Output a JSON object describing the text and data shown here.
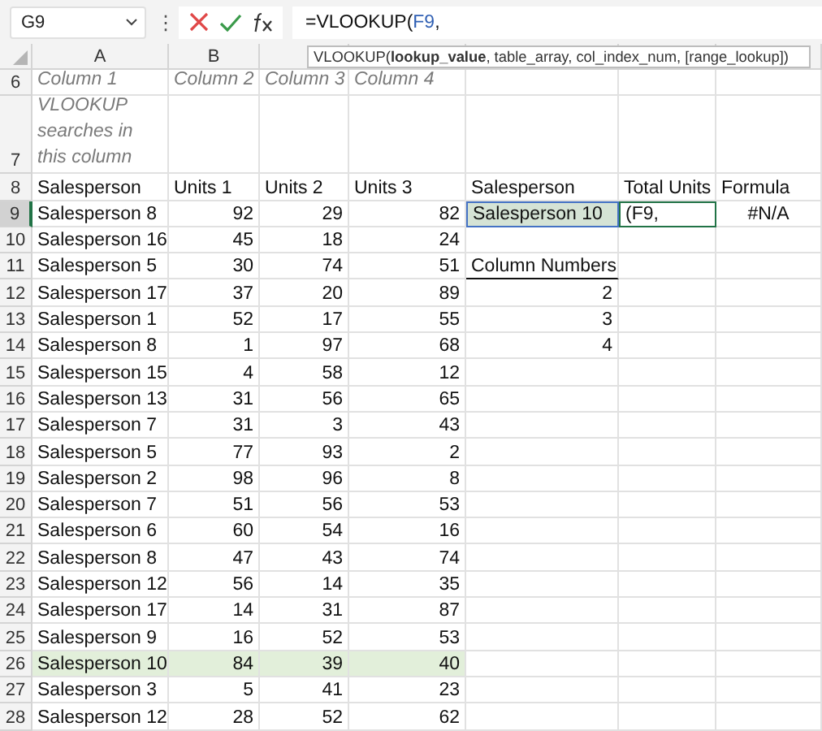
{
  "formula_bar": {
    "name_box": "G9",
    "separator": "⋮",
    "formula_start": "=VLOOKUP(",
    "formula_reference": "F9",
    "formula_end": ","
  },
  "tooltip": {
    "text": "VLOOKUP(**lookup_value**, table_array, col_index_num, [range_lookup])"
  },
  "column_headers": [
    "A",
    "B"
  ],
  "rows": [
    {
      "number": "6",
      "kind": "caption",
      "selected": false,
      "highlighted": false,
      "cells": [
        {
          "text": "Column 1",
          "kind": "text"
        },
        {
          "text": "Column 2",
          "kind": "text"
        },
        {
          "text": "Column 3",
          "kind": "text"
        },
        {
          "text": "Column 4",
          "kind": "text"
        }
      ]
    },
    {
      "number": "7",
      "kind": "caption",
      "selected": false,
      "highlighted": false,
      "cells": [
        {
          "text": "VLOOKUP searches in this column",
          "kind": "text"
        }
      ]
    },
    {
      "number": "8",
      "kind": "header",
      "selected": false,
      "highlighted": false,
      "cells": [
        {
          "text": "Salesperson",
          "kind": "text"
        },
        {
          "text": "Units 1",
          "kind": "text"
        },
        {
          "text": "Units 2",
          "kind": "text"
        },
        {
          "text": "Units 3",
          "kind": "text"
        },
        {
          "text": "Salesperson",
          "kind": "text"
        },
        {
          "text": "Total Units",
          "kind": "text"
        },
        {
          "text": "Formula",
          "kind": "text"
        }
      ]
    },
    {
      "number": "9",
      "kind": "data",
      "selected": true,
      "highlighted": false,
      "cells": [
        {
          "text": "Salesperson 8",
          "kind": "text"
        },
        {
          "text": "92",
          "kind": "number"
        },
        {
          "text": "29",
          "kind": "number"
        },
        {
          "text": "82",
          "kind": "number"
        },
        {
          "text": "Salesperson 10",
          "kind": "reference"
        },
        {
          "text": "(F9,",
          "kind": "editing"
        },
        {
          "text": "#N/A",
          "kind": "error"
        }
      ]
    },
    {
      "number": "10",
      "kind": "data",
      "selected": false,
      "highlighted": false,
      "cells": [
        {
          "text": "Salesperson 16",
          "kind": "text"
        },
        {
          "text": "45",
          "kind": "number"
        },
        {
          "text": "18",
          "kind": "number"
        },
        {
          "text": "24",
          "kind": "number"
        }
      ]
    },
    {
      "number": "11",
      "kind": "data",
      "selected": false,
      "highlighted": false,
      "cells": [
        {
          "text": "Salesperson 5",
          "kind": "text"
        },
        {
          "text": "30",
          "kind": "number"
        },
        {
          "text": "74",
          "kind": "number"
        },
        {
          "text": "51",
          "kind": "number"
        },
        {
          "text": "Column Numbers",
          "kind": "underlined"
        }
      ]
    },
    {
      "number": "12",
      "kind": "data",
      "selected": false,
      "highlighted": false,
      "cells": [
        {
          "text": "Salesperson 17",
          "kind": "text"
        },
        {
          "text": "37",
          "kind": "number"
        },
        {
          "text": "20",
          "kind": "number"
        },
        {
          "text": "89",
          "kind": "number"
        },
        {
          "text": "2",
          "kind": "number"
        }
      ]
    },
    {
      "number": "13",
      "kind": "data",
      "selected": false,
      "highlighted": false,
      "cells": [
        {
          "text": "Salesperson 1",
          "kind": "text"
        },
        {
          "text": "52",
          "kind": "number"
        },
        {
          "text": "17",
          "kind": "number"
        },
        {
          "text": "55",
          "kind": "number"
        },
        {
          "text": "3",
          "kind": "number"
        }
      ]
    },
    {
      "number": "14",
      "kind": "data",
      "selected": false,
      "highlighted": false,
      "cells": [
        {
          "text": "Salesperson 8",
          "kind": "text"
        },
        {
          "text": "1",
          "kind": "number"
        },
        {
          "text": "97",
          "kind": "number"
        },
        {
          "text": "68",
          "kind": "number"
        },
        {
          "text": "4",
          "kind": "number"
        }
      ]
    },
    {
      "number": "15",
      "kind": "data",
      "selected": false,
      "highlighted": false,
      "cells": [
        {
          "text": "Salesperson 15",
          "kind": "text"
        },
        {
          "text": "4",
          "kind": "number"
        },
        {
          "text": "58",
          "kind": "number"
        },
        {
          "text": "12",
          "kind": "number"
        }
      ]
    },
    {
      "number": "16",
      "kind": "data",
      "selected": false,
      "highlighted": false,
      "cells": [
        {
          "text": "Salesperson 13",
          "kind": "text"
        },
        {
          "text": "31",
          "kind": "number"
        },
        {
          "text": "56",
          "kind": "number"
        },
        {
          "text": "65",
          "kind": "number"
        }
      ]
    },
    {
      "number": "17",
      "kind": "data",
      "selected": false,
      "highlighted": false,
      "cells": [
        {
          "text": "Salesperson 7",
          "kind": "text"
        },
        {
          "text": "31",
          "kind": "number"
        },
        {
          "text": "3",
          "kind": "number"
        },
        {
          "text": "43",
          "kind": "number"
        }
      ]
    },
    {
      "number": "18",
      "kind": "data",
      "selected": false,
      "highlighted": false,
      "cells": [
        {
          "text": "Salesperson 5",
          "kind": "text"
        },
        {
          "text": "77",
          "kind": "number"
        },
        {
          "text": "93",
          "kind": "number"
        },
        {
          "text": "2",
          "kind": "number"
        }
      ]
    },
    {
      "number": "19",
      "kind": "data",
      "selected": false,
      "highlighted": false,
      "cells": [
        {
          "text": "Salesperson 2",
          "kind": "text"
        },
        {
          "text": "98",
          "kind": "number"
        },
        {
          "text": "96",
          "kind": "number"
        },
        {
          "text": "8",
          "kind": "number"
        }
      ]
    },
    {
      "number": "20",
      "kind": "data",
      "selected": false,
      "highlighted": false,
      "cells": [
        {
          "text": "Salesperson 7",
          "kind": "text"
        },
        {
          "text": "51",
          "kind": "number"
        },
        {
          "text": "56",
          "kind": "number"
        },
        {
          "text": "53",
          "kind": "number"
        }
      ]
    },
    {
      "number": "21",
      "kind": "data",
      "selected": false,
      "highlighted": false,
      "cells": [
        {
          "text": "Salesperson 6",
          "kind": "text"
        },
        {
          "text": "60",
          "kind": "number"
        },
        {
          "text": "54",
          "kind": "number"
        },
        {
          "text": "16",
          "kind": "number"
        }
      ]
    },
    {
      "number": "22",
      "kind": "data",
      "selected": false,
      "highlighted": false,
      "cells": [
        {
          "text": "Salesperson 8",
          "kind": "text"
        },
        {
          "text": "47",
          "kind": "number"
        },
        {
          "text": "43",
          "kind": "number"
        },
        {
          "text": "74",
          "kind": "number"
        }
      ]
    },
    {
      "number": "23",
      "kind": "data",
      "selected": false,
      "highlighted": false,
      "cells": [
        {
          "text": "Salesperson 12",
          "kind": "text"
        },
        {
          "text": "56",
          "kind": "number"
        },
        {
          "text": "14",
          "kind": "number"
        },
        {
          "text": "35",
          "kind": "number"
        }
      ]
    },
    {
      "number": "24",
      "kind": "data",
      "selected": false,
      "highlighted": false,
      "cells": [
        {
          "text": "Salesperson 17",
          "kind": "text"
        },
        {
          "text": "14",
          "kind": "number"
        },
        {
          "text": "31",
          "kind": "number"
        },
        {
          "text": "87",
          "kind": "number"
        }
      ]
    },
    {
      "number": "25",
      "kind": "data",
      "selected": false,
      "highlighted": false,
      "cells": [
        {
          "text": "Salesperson 9",
          "kind": "text"
        },
        {
          "text": "16",
          "kind": "number"
        },
        {
          "text": "52",
          "kind": "number"
        },
        {
          "text": "53",
          "kind": "number"
        }
      ]
    },
    {
      "number": "26",
      "kind": "data",
      "selected": false,
      "highlighted": true,
      "cells": [
        {
          "text": "Salesperson 10",
          "kind": "text"
        },
        {
          "text": "84",
          "kind": "number"
        },
        {
          "text": "39",
          "kind": "number"
        },
        {
          "text": "40",
          "kind": "number"
        }
      ]
    },
    {
      "number": "27",
      "kind": "data",
      "selected": false,
      "highlighted": false,
      "cells": [
        {
          "text": "Salesperson 3",
          "kind": "text"
        },
        {
          "text": "5",
          "kind": "number"
        },
        {
          "text": "41",
          "kind": "number"
        },
        {
          "text": "23",
          "kind": "number"
        }
      ]
    },
    {
      "number": "28",
      "kind": "data",
      "selected": false,
      "highlighted": false,
      "cells": [
        {
          "text": "Salesperson 12",
          "kind": "text"
        },
        {
          "text": "28",
          "kind": "number"
        },
        {
          "text": "52",
          "kind": "number"
        },
        {
          "text": "62",
          "kind": "number"
        }
      ]
    }
  ]
}
